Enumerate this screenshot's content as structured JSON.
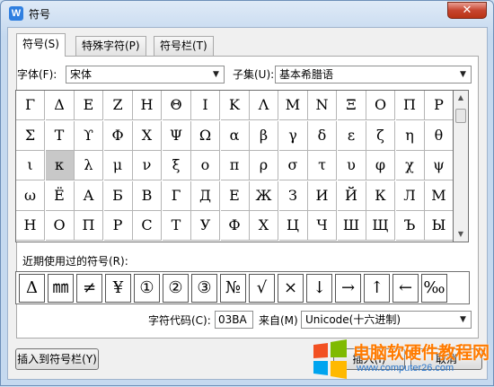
{
  "window": {
    "title": "符号",
    "app_icon": "W",
    "close_glyph": "✕"
  },
  "tabs": [
    {
      "label": "符号(S)"
    },
    {
      "label": "特殊字符(P)"
    },
    {
      "label": "符号栏(T)"
    }
  ],
  "font": {
    "label": "字体(F):",
    "value": "宋体"
  },
  "subset": {
    "label": "子集(U):",
    "value": "基本希腊语"
  },
  "grid": {
    "rows": [
      [
        "Γ",
        "Δ",
        "Ε",
        "Ζ",
        "Η",
        "Θ",
        "Ι",
        "Κ",
        "Λ",
        "Μ",
        "Ν",
        "Ξ",
        "Ο",
        "Π",
        "Ρ"
      ],
      [
        "Σ",
        "Τ",
        "ϒ",
        "Φ",
        "Χ",
        "Ψ",
        "Ω",
        "α",
        "β",
        "γ",
        "δ",
        "ε",
        "ζ",
        "η",
        "θ"
      ],
      [
        "ι",
        "κ",
        "λ",
        "μ",
        "ν",
        "ξ",
        "ο",
        "π",
        "ρ",
        "σ",
        "τ",
        "υ",
        "φ",
        "χ",
        "ψ"
      ],
      [
        "ω",
        "Ё",
        "А",
        "Б",
        "В",
        "Г",
        "Д",
        "Е",
        "Ж",
        "З",
        "И",
        "Й",
        "К",
        "Л",
        "М"
      ],
      [
        "Н",
        "О",
        "П",
        "Р",
        "С",
        "Т",
        "У",
        "Ф",
        "Х",
        "Ц",
        "Ч",
        "Ш",
        "Щ",
        "Ъ",
        "Ы"
      ]
    ],
    "selected": "κ"
  },
  "recent": {
    "label": "近期使用过的符号(R):",
    "symbols": [
      "Δ",
      "㎜",
      "≠",
      "¥",
      "①",
      "②",
      "③",
      "№",
      "√",
      "×",
      "↓",
      "→",
      "↑",
      "←",
      "‰"
    ]
  },
  "char_code": {
    "label": "字符代码(C):",
    "value": "03BA"
  },
  "from": {
    "label": "来自(M)",
    "value": "Unicode(十六进制)"
  },
  "buttons": {
    "insert_to_bar": "插入到符号栏(Y)",
    "insert": "插入(I)",
    "cancel": "取消"
  },
  "watermark": {
    "text": "电脑软硬件教程网",
    "url": "www.computer26.com"
  }
}
